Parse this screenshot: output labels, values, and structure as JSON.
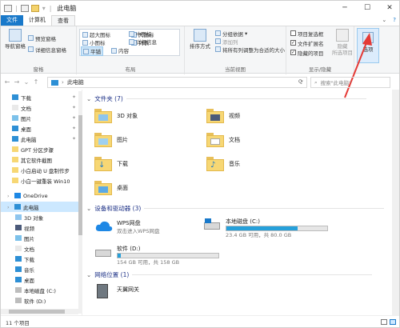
{
  "window": {
    "title": "此电脑",
    "controls": {
      "minimize": "─",
      "maximize": "☐",
      "close": "✕"
    }
  },
  "tabs": [
    {
      "label": "文件"
    },
    {
      "label": "计算机"
    },
    {
      "label": "查看"
    }
  ],
  "ribbon": {
    "panes": {
      "nav_pane": "导航窗格",
      "preview_pane": "预览窗格",
      "details_pane": "详细信息窗格",
      "group_label": "窗格"
    },
    "layout": {
      "items": [
        "超大图标",
        "大图标",
        "中图标",
        "小图标",
        "列表",
        "详细信息",
        "平铺",
        "内容"
      ],
      "group_label": "布局"
    },
    "current_view": {
      "sort_by": "排序方式",
      "group_by": "分组依据",
      "add_columns": "添加列",
      "fit_columns": "将所有列调整为合适的大小",
      "group_label": "当前视图"
    },
    "show_hide": {
      "item_checkboxes": "项目复选框",
      "file_extensions": "文件扩展名",
      "hidden_items": "隐藏的项目",
      "hide_selected": "隐藏",
      "hide_selected_2": "所选项目",
      "group_label": "显示/隐藏"
    },
    "options": "选项"
  },
  "address": {
    "path": "此电脑",
    "search_placeholder": "搜索\"此电脑\""
  },
  "sidebar": {
    "items": [
      {
        "label": "下载",
        "icon": "download-icon",
        "pinned": true
      },
      {
        "label": "文档",
        "icon": "document-icon",
        "pinned": true
      },
      {
        "label": "图片",
        "icon": "picture-icon",
        "pinned": true
      },
      {
        "label": "桌面",
        "icon": "desktop-icon",
        "pinned": true
      },
      {
        "label": "此电脑",
        "icon": "computer-icon",
        "pinned": true
      },
      {
        "label": "GPT 分区步骤",
        "icon": "folder-icon"
      },
      {
        "label": "其它软件截图",
        "icon": "folder-icon"
      },
      {
        "label": "小白启动 U 盘制作步",
        "icon": "folder-icon"
      },
      {
        "label": "小白一键重装 Win10",
        "icon": "folder-icon"
      },
      {
        "label": "OneDrive",
        "icon": "cloud-icon"
      },
      {
        "label": "此电脑",
        "icon": "computer-icon",
        "selected": true
      },
      {
        "label": "3D 对象",
        "icon": "3d-icon"
      },
      {
        "label": "视频",
        "icon": "video-icon"
      },
      {
        "label": "图片",
        "icon": "picture-icon"
      },
      {
        "label": "文档",
        "icon": "document-icon"
      },
      {
        "label": "下载",
        "icon": "download-icon"
      },
      {
        "label": "音乐",
        "icon": "music-icon"
      },
      {
        "label": "桌面",
        "icon": "desktop-icon"
      },
      {
        "label": "本地磁盘 (C:)",
        "icon": "drive-icon"
      },
      {
        "label": "软件 (D:)",
        "icon": "drive-icon"
      }
    ]
  },
  "sections": {
    "folders": "文件夹 (7)",
    "devices": "设备和驱动器 (3)",
    "network": "网络位置 (1)"
  },
  "folders": [
    {
      "label": "3D 对象"
    },
    {
      "label": "视频"
    },
    {
      "label": "图片"
    },
    {
      "label": "文档"
    },
    {
      "label": "下载"
    },
    {
      "label": "音乐"
    },
    {
      "label": "桌面"
    }
  ],
  "devices": [
    {
      "name": "WPS网盘",
      "sub": "双击进入WPS网盘"
    },
    {
      "name": "本地磁盘 (C:)",
      "sub": "23.4 GB 可用，共 80.0 GB",
      "used_fraction": 0.71
    },
    {
      "name": "软件 (D:)",
      "sub": "154 GB 可用，共 158 GB",
      "used_fraction": 0.03
    }
  ],
  "network": [
    {
      "name": "天翼网关"
    }
  ],
  "status": {
    "count": "11 个项目"
  },
  "colors": {
    "accent": "#1979ca",
    "selection": "#cce8ff",
    "folder": "#f7d774",
    "bar_fill": "#26a0da",
    "arrow": "#e53935"
  }
}
